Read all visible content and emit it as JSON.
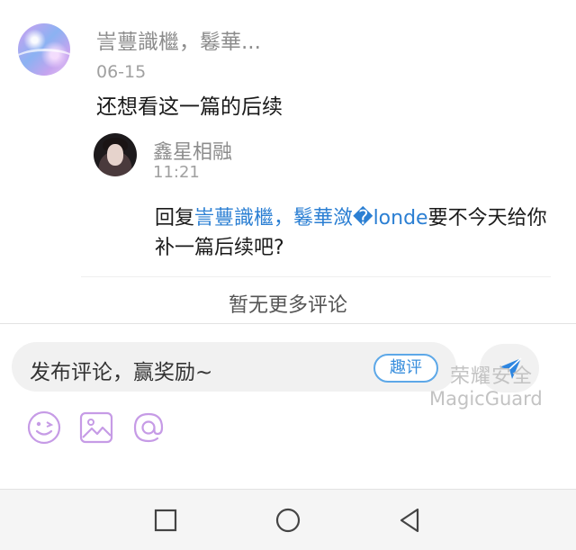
{
  "comment": {
    "author": "訔蘴識檵，鬈華...",
    "date": "06-15",
    "text": "还想看这一篇的后续",
    "avatar_icon": "pastel-sky-avatar"
  },
  "reply": {
    "author": "鑫星相融",
    "time": "11:21",
    "prefix": "回复",
    "mention": "訔蘴識檵，鬈華潋�londe",
    "body": "要不今天给你补一篇后续吧?",
    "avatar_icon": "person-avatar"
  },
  "footer": {
    "no_more": "暂无更多评论"
  },
  "composer": {
    "placeholder": "发布评论，赢奖励~",
    "fun_button": "趣评",
    "send_icon": "send-icon",
    "tools": [
      "emoji-icon",
      "image-icon",
      "at-icon"
    ]
  },
  "watermark": {
    "cn": "荣耀安全",
    "en": "MagicGuard"
  },
  "nav": {
    "icons": [
      "square-recent-icon",
      "circle-home-icon",
      "triangle-back-icon"
    ]
  },
  "colors": {
    "accent": "#2b7fd3",
    "tool_purple": "#c69be6",
    "send_blue": "#2e86e0"
  }
}
